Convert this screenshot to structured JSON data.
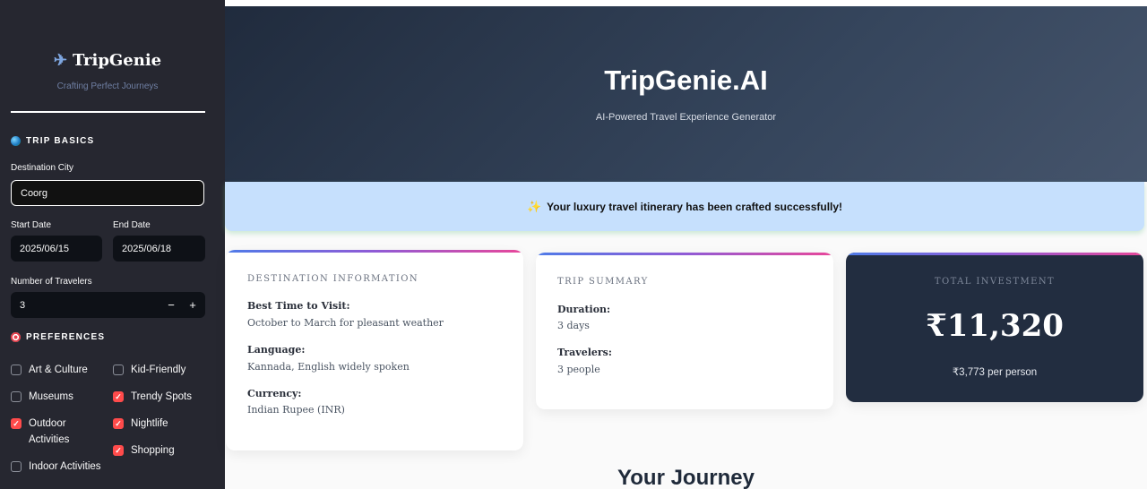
{
  "sidebar": {
    "brand_icon": "airplane-icon",
    "brand_title": "TripGenie",
    "brand_subtitle": "Crafting Perfect Journeys",
    "trip_basics_heading": "TRIP BASICS",
    "destination_label": "Destination City",
    "destination_value": "Coorg",
    "start_date_label": "Start Date",
    "start_date_value": "2025/06/15",
    "end_date_label": "End Date",
    "end_date_value": "2025/06/18",
    "travelers_label": "Number of Travelers",
    "travelers_value": "3",
    "minus_label": "−",
    "plus_label": "+",
    "preferences_heading": "PREFERENCES",
    "preferences": [
      {
        "label": "Art & Culture",
        "checked": false
      },
      {
        "label": "Kid-Friendly",
        "checked": false
      },
      {
        "label": "Museums",
        "checked": false
      },
      {
        "label": "Trendy Spots",
        "checked": true
      },
      {
        "label": "Outdoor Activities",
        "checked": true
      },
      {
        "label": "Nightlife",
        "checked": true
      },
      {
        "label": "Shopping",
        "checked": true
      },
      {
        "label": "Indoor Activities",
        "checked": false
      }
    ],
    "accent_color": "#ff4b4b"
  },
  "hero": {
    "title": "TripGenie.AI",
    "subtitle": "AI-Powered Travel Experience Generator"
  },
  "alert": {
    "icon": "sparkles-icon",
    "text": "Your luxury travel itinerary has been crafted successfully!"
  },
  "destination_card": {
    "heading": "DESTINATION INFORMATION",
    "best_time_label": "Best Time to Visit:",
    "best_time_value": "October to March for pleasant weather",
    "language_label": "Language:",
    "language_value": "Kannada, English widely spoken",
    "currency_label": "Currency:",
    "currency_value": "Indian Rupee (INR)"
  },
  "summary_card": {
    "heading": "TRIP SUMMARY",
    "duration_label": "Duration:",
    "duration_value": "3 days",
    "travelers_label": "Travelers:",
    "travelers_value": "3 people"
  },
  "investment_card": {
    "heading": "TOTAL INVESTMENT",
    "amount": "₹11,320",
    "per_person": "₹3,773 per person"
  },
  "journey_heading": "Your Journey"
}
